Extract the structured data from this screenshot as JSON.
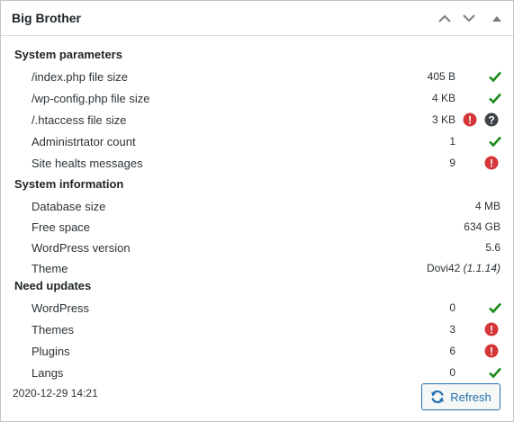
{
  "widget": {
    "title": "Big Brother",
    "controls": [
      "move-up",
      "move-down",
      "toggle-collapse"
    ]
  },
  "colors": {
    "ok": "#1a8a1a",
    "error": "#d63638",
    "unknown": "#3c434a",
    "accent": "#2271b1"
  },
  "sections": [
    {
      "title": "System parameters",
      "rows": [
        {
          "label": "/index.php file size",
          "value": "405 B",
          "status": "ok"
        },
        {
          "label": "/wp-config.php file size",
          "value": "4 KB",
          "status": "ok"
        },
        {
          "label": "/.htaccess file size",
          "value": "3 KB",
          "status": "error+unknown"
        },
        {
          "label": "Administrtator count",
          "value": "1",
          "status": "ok"
        },
        {
          "label": "Site healts messages",
          "value": "9",
          "status": "error"
        }
      ]
    },
    {
      "title": "System information",
      "rows": [
        {
          "label": "Database size",
          "value": "4 MB"
        },
        {
          "label": "Free space",
          "value": "634 GB"
        },
        {
          "label": "WordPress version",
          "value": "5.6"
        },
        {
          "label": "Theme",
          "value": "Dovi42",
          "version": "(1.1.14)"
        }
      ]
    },
    {
      "title": "Need updates",
      "rows": [
        {
          "label": "WordPress",
          "value": "0",
          "status": "ok"
        },
        {
          "label": "Themes",
          "value": "3",
          "status": "error"
        },
        {
          "label": "Plugins",
          "value": "6",
          "status": "error"
        },
        {
          "label": "Langs",
          "value": "0",
          "status": "ok"
        }
      ]
    }
  ],
  "footer": {
    "timestamp": "2020-12-29 14:21",
    "refresh_label": "Refresh",
    "refresh_icon": "refresh-icon"
  }
}
